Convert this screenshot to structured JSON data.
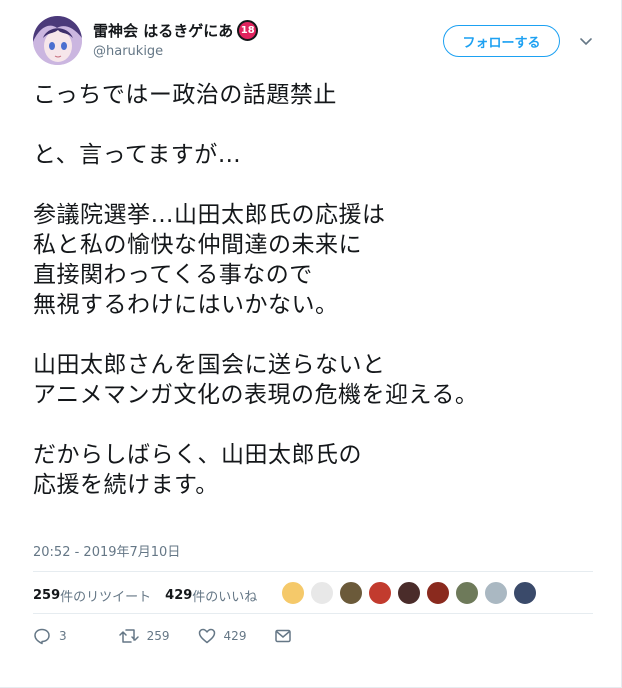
{
  "user": {
    "display_name": "雷神会 はるきゲにあ",
    "badge": "18",
    "handle": "@harukige"
  },
  "follow_label": "フォローする",
  "tweet_lines": [
    "こっちではー政治の話題禁止",
    "",
    "と、言ってますが…",
    "",
    "参議院選挙…山田太郎氏の応援は",
    "私と私の愉快な仲間達の未来に",
    "直接関わってくる事なので",
    "無視するわけにはいかない。",
    "",
    "山田太郎さんを国会に送らないと",
    "アニメマンガ文化の表現の危機を迎える。",
    "",
    "だからしばらく、山田太郎氏の",
    "応援を続けます。"
  ],
  "timestamp": "20:52 - 2019年7月10日",
  "stats": {
    "retweets_count": "259",
    "retweets_label": "件のリツイート",
    "likes_count": "429",
    "likes_label": "件のいいね"
  },
  "liker_avatars": [
    {
      "icon": "avatar-1",
      "color": "#f5c96a"
    },
    {
      "icon": "avatar-2",
      "color": "#e8e8e8"
    },
    {
      "icon": "avatar-3",
      "color": "#6b5a3a"
    },
    {
      "icon": "avatar-4",
      "color": "#c23b2e"
    },
    {
      "icon": "avatar-5",
      "color": "#4a2c2a"
    },
    {
      "icon": "avatar-6",
      "color": "#8a2a1e"
    },
    {
      "icon": "avatar-7",
      "color": "#6e7a5a"
    },
    {
      "icon": "avatar-8",
      "color": "#aab8c2"
    },
    {
      "icon": "avatar-9",
      "color": "#3a4a6a"
    }
  ],
  "actions": {
    "reply_count": "3",
    "retweet_count": "259",
    "like_count": "429"
  },
  "colors": {
    "accent": "#1da1f2",
    "text": "#14171a",
    "muted": "#657786",
    "border": "#e6ecf0"
  }
}
